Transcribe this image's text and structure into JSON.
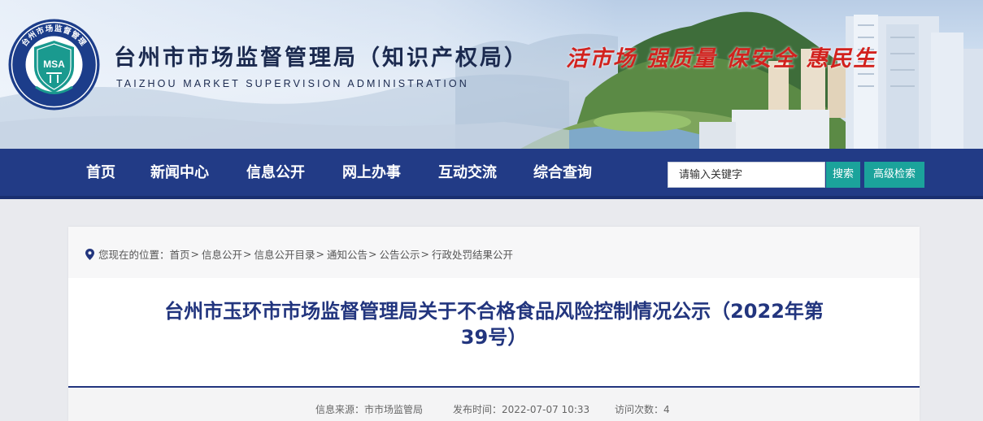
{
  "header": {
    "logo_text": "MSA",
    "logo_ring_text": "台州市场监督管理",
    "logo_ring_text_en": "TAIZHOU MARKET SUPERVISION ADMINISTRATION",
    "title": "台州市市场监督管理局（知识产权局）",
    "subtitle": "TAIZHOU MARKET SUPERVISION ADMINISTRATION",
    "slogan": "活市场  强质量  保安全  惠民生"
  },
  "nav": {
    "items": [
      {
        "label": "首页"
      },
      {
        "label": "新闻中心"
      },
      {
        "label": "信息公开"
      },
      {
        "label": "网上办事"
      },
      {
        "label": "互动交流"
      },
      {
        "label": "综合查询"
      }
    ],
    "search_placeholder": "请输入关键字",
    "search_button": "搜索",
    "advanced_button": "高级检索"
  },
  "breadcrumb": {
    "prefix": "您现在的位置：",
    "items": [
      "首页",
      "信息公开",
      "信息公开目录",
      "通知公告",
      "公告公示",
      "行政处罚结果公开"
    ]
  },
  "article": {
    "title_line1": "台州市玉环市市场监督管理局关于不合格食品风险控制情况公示（2022年第",
    "title_line2": "39号）",
    "source": "信息来源：市市场监管局",
    "publish_time": "发布时间：2022-07-07 10:33",
    "views": "访问次数：4"
  },
  "colors": {
    "nav_bg": "#223b86",
    "accent_teal": "#1ba39b",
    "title_blue": "#22357e",
    "slogan_red": "#d2221e"
  }
}
